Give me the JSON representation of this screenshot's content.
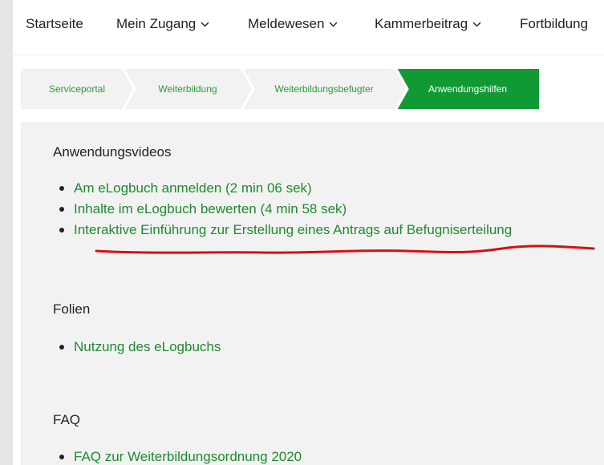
{
  "nav": {
    "items": [
      {
        "label": "Startseite",
        "dropdown": false
      },
      {
        "label": "Mein Zugang",
        "dropdown": true
      },
      {
        "label": "Meldewesen",
        "dropdown": true
      },
      {
        "label": "Kammerbeitrag",
        "dropdown": true
      },
      {
        "label": "Fortbildung",
        "dropdown": false
      }
    ]
  },
  "breadcrumb": {
    "items": [
      "Serviceportal",
      "Weiterbildung",
      "Weiterbildungsbefugter",
      "Anwendungshilfen"
    ],
    "active_index": 3,
    "active_color": "#119a34"
  },
  "sections": [
    {
      "title": "Anwendungsvideos",
      "links": [
        "Am eLogbuch anmelden (2 min 06 sek)",
        "Inhalte im eLogbuch bewerten (4 min 58 sek)",
        "Interaktive Einführung zur Erstellung eines Antrags auf Befugniserteilung"
      ]
    },
    {
      "title": "Folien",
      "links": [
        "Nutzung des eLogbuchs"
      ]
    },
    {
      "title": "FAQ",
      "links": [
        "FAQ zur Weiterbildungsordnung 2020"
      ]
    }
  ],
  "colors": {
    "link": "#1f8a2e",
    "annotation_underline": "#d31212"
  }
}
